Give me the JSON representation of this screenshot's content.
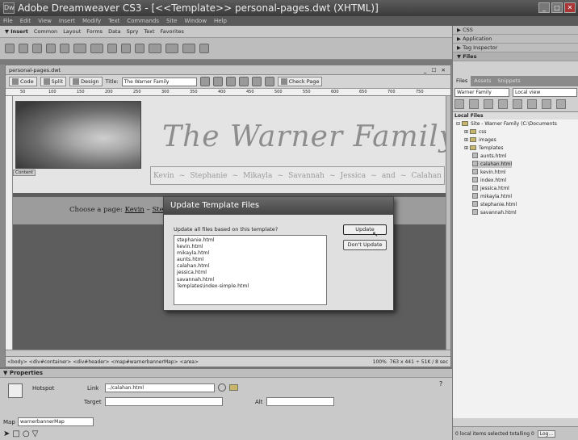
{
  "window": {
    "title": "Adobe Dreamweaver CS3 - [<<Template>> personal-pages.dwt (XHTML)]",
    "controls": [
      "_",
      "□",
      "✕"
    ]
  },
  "menu": [
    "File",
    "Edit",
    "View",
    "Insert",
    "Modify",
    "Text",
    "Commands",
    "Site",
    "Window",
    "Help"
  ],
  "insert_bar": {
    "label": "▼ Insert",
    "tabs": [
      "Common",
      "Layout",
      "Forms",
      "Data",
      "Spry",
      "Text",
      "Favorites"
    ]
  },
  "document": {
    "tab_name": "personal-pages.dwt",
    "tab_controls": "_ ☐ ✕",
    "view_buttons": [
      "Code",
      "Split",
      "Design"
    ],
    "title_label": "Title:",
    "title_value": "The Warner Family",
    "check_page": "Check Page",
    "ruler_ticks": [
      "50",
      "100",
      "150",
      "200",
      "250",
      "300",
      "350",
      "400",
      "450",
      "500",
      "550",
      "600",
      "650",
      "700",
      "750"
    ],
    "content_label": "Content",
    "family_title": "The Warner Family",
    "nav_links": [
      "Kevin",
      "Stephanie",
      "Mikayla",
      "Savannah",
      "Jessica",
      "and",
      "Calahan"
    ],
    "choose_prefix": "Choose a page: ",
    "choose_link1": "Kevin",
    "choose_sep": " – ",
    "choose_link2": "Steph"
  },
  "status": {
    "tags": "<body> <div#container> <div#header> <map#warnerbannerMap> <area>",
    "zoom": "100%",
    "size": "763 x 441 ÷ 51K / 8 sec"
  },
  "properties": {
    "header": "▼ Properties",
    "type_label": "Hotspot",
    "link_label": "Link",
    "link_value": "../calahan.html",
    "target_label": "Target",
    "alt_label": "Alt",
    "map_label": "Map",
    "map_value": "warnerbannerMap"
  },
  "dialog": {
    "title": "Update Template Files",
    "question": "Update all files based on this template?",
    "files": [
      "stephanie.html",
      "kevin.html",
      "mikayla.html",
      "aunts.html",
      "calahan.html",
      "jessica.html",
      "savannah.html",
      "Templates\\index-simple.html"
    ],
    "update_label": "Update",
    "dont_update_label": "Don't Update"
  },
  "panels": {
    "css": "▶ CSS",
    "application": "▶ Application",
    "tag_inspector": "▶ Tag Inspector",
    "files": "▼ Files",
    "tabs": [
      "Files",
      "Assets",
      "Snippets"
    ],
    "site_select": "Warner Family",
    "view_select": "Local view",
    "local_files_header": "Local Files",
    "site_root": "Site - Warner Family (C:\\Documents",
    "folders": [
      "css",
      "images",
      "Templates"
    ],
    "files_list": [
      "aunts.html",
      "calahan.html",
      "kevin.html",
      "index.html",
      "jessica.html",
      "mikayla.html",
      "stephanie.html",
      "savannah.html"
    ],
    "status_text": "0 local items selected totalling 0",
    "log_button": "Log..."
  }
}
